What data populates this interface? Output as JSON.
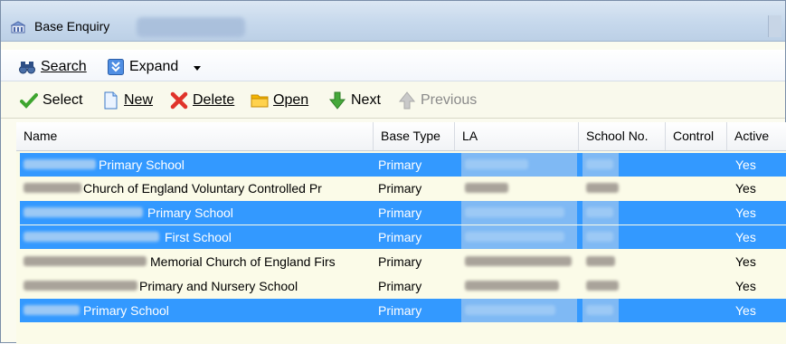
{
  "window": {
    "title": "Base Enquiry"
  },
  "toolbar1": {
    "search_label": "Search",
    "expand_label": "Expand"
  },
  "toolbar2": {
    "select_label": "Select",
    "new_label": "New",
    "delete_label": "Delete",
    "open_label": "Open",
    "next_label": "Next",
    "previous_label": "Previous"
  },
  "grid": {
    "columns": [
      "Name",
      "Base Type",
      "LA",
      "School No.",
      "Control",
      "Active"
    ],
    "rows": [
      {
        "name": "Primary School",
        "base_type": "Primary",
        "active": "Yes",
        "selected": true
      },
      {
        "name": "Church of England Voluntary Controlled Pr",
        "base_type": "Primary",
        "active": "Yes",
        "selected": false
      },
      {
        "name": "Primary School",
        "base_type": "Primary",
        "active": "Yes",
        "selected": true
      },
      {
        "name": "First School",
        "base_type": "Primary",
        "active": "Yes",
        "selected": true
      },
      {
        "name": "Memorial Church of England Firs",
        "base_type": "Primary",
        "active": "Yes",
        "selected": false
      },
      {
        "name": "Primary and Nursery School",
        "base_type": "Primary",
        "active": "Yes",
        "selected": false
      },
      {
        "name": "Primary School",
        "base_type": "Primary",
        "active": "Yes",
        "selected": true
      }
    ]
  },
  "colors": {
    "selection": "#3399ff",
    "grid_background": "#fbfbe8",
    "disabled_text": "#8a8a8a"
  }
}
